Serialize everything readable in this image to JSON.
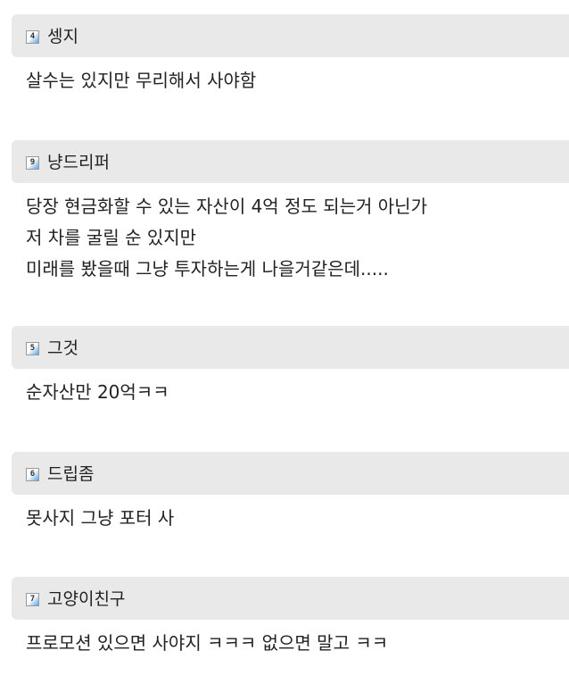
{
  "comments": [
    {
      "level": "4",
      "nickname": "셍지",
      "lines": [
        "살수는 있지만 무리해서 사야함"
      ]
    },
    {
      "level": "9",
      "nickname": "냥드리퍼",
      "lines": [
        "당장 현금화할 수 있는 자산이 4억 정도 되는거 아닌가",
        "저 차를 굴릴 순 있지만",
        "미래를 봤을때 그냥 투자하는게 나을거같은데....."
      ]
    },
    {
      "level": "5",
      "nickname": "그것",
      "lines": [
        "순자산만 20억ㅋㅋ"
      ]
    },
    {
      "level": "6",
      "nickname": "드립좀",
      "lines": [
        "못사지 그냥 포터 사"
      ]
    },
    {
      "level": "7",
      "nickname": "고양이친구",
      "lines": [
        "프로모션 있으면 사야지 ㅋㅋㅋ 없으면 말고 ㅋㅋ"
      ]
    }
  ],
  "icons": {
    "level_badge": "level-badge-icon"
  },
  "colors": {
    "header_bg": "#e9e9e9",
    "text": "#222222",
    "badge_accent": "#5aa3e6"
  }
}
